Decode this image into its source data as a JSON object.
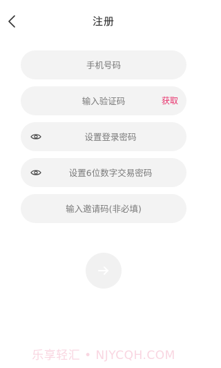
{
  "header": {
    "title": "注册",
    "back_icon": "chevron-left-icon"
  },
  "form": {
    "phone": {
      "placeholder": "手机号码"
    },
    "code": {
      "placeholder": "输入验证码",
      "action_label": "获取"
    },
    "login_password": {
      "placeholder": "设置登录密码",
      "icon": "eye-icon"
    },
    "trade_password": {
      "placeholder": "设置6位数字交易密码",
      "icon": "eye-icon"
    },
    "invite_code": {
      "placeholder": "输入邀请码(非必填)"
    },
    "submit_icon": "arrow-right-icon"
  },
  "watermark": "乐享轻汇 • NJYCQH.COM",
  "colors": {
    "accent": "#e8336d",
    "field_bg": "#f3f3f3",
    "placeholder": "#7a7a7a"
  }
}
